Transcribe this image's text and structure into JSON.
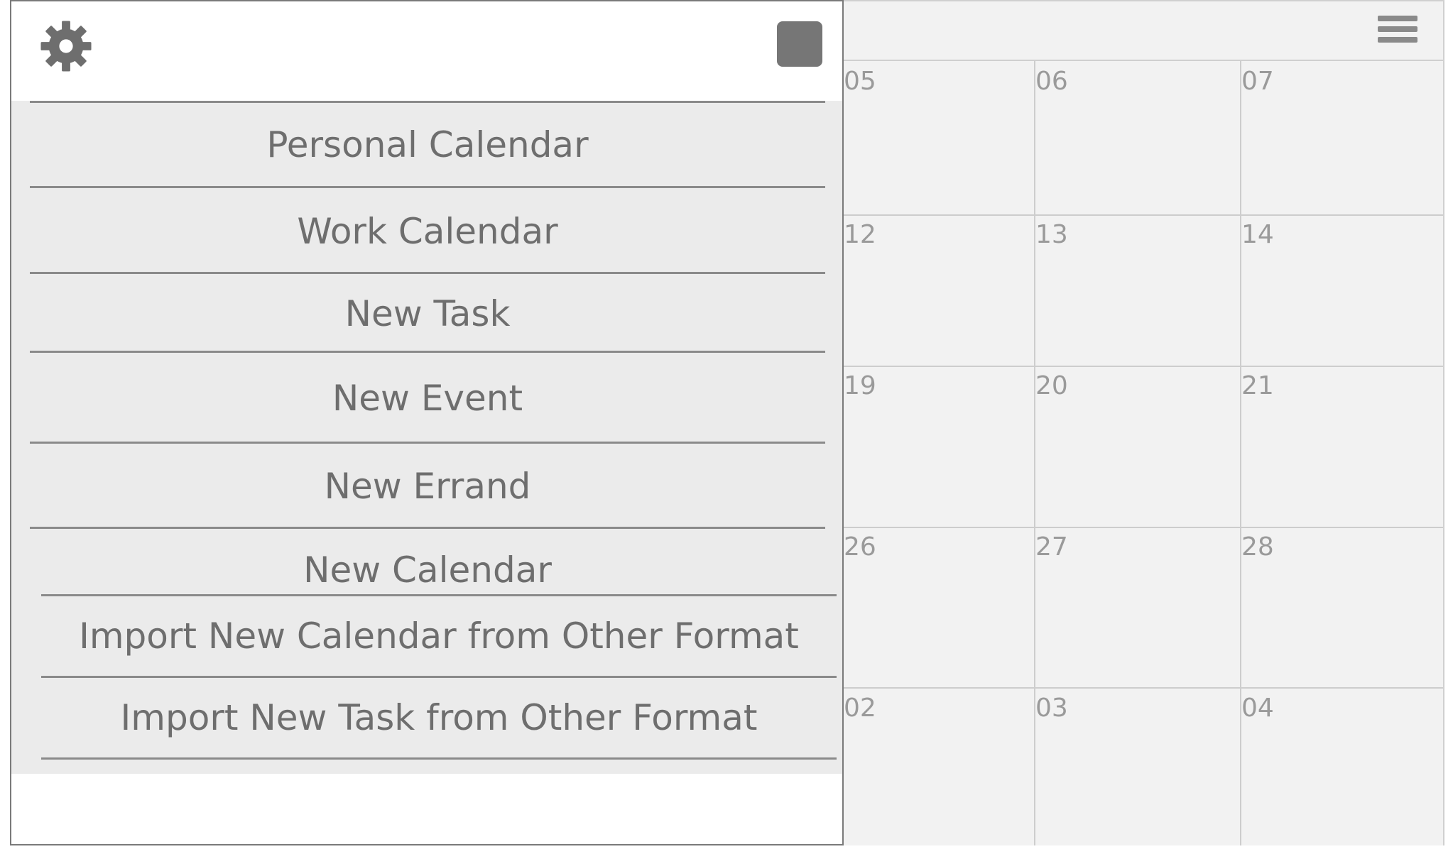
{
  "calendar": {
    "weeks": [
      [
        "05",
        "06",
        "07"
      ],
      [
        "12",
        "13",
        "14"
      ],
      [
        "19",
        "20",
        "21"
      ],
      [
        "26",
        "27",
        "28"
      ],
      [
        "02",
        "03",
        "04"
      ]
    ]
  },
  "drawer": {
    "menu": [
      "Personal Calendar",
      "Work Calendar",
      "New Task",
      "New Event",
      "New Errand",
      "New Calendar",
      "Import New Calendar from Other Format",
      "Import New Task from Other Format"
    ]
  },
  "icons": {
    "settings": "gear-icon",
    "close": "square-button-icon",
    "menu": "hamburger-icon"
  },
  "colors": {
    "menu_bg": "#ebebeb",
    "text": "#6e6e6e",
    "calendar_bg": "#f2f2f2",
    "day_number": "#9a9a9a",
    "icon": "#767676"
  }
}
